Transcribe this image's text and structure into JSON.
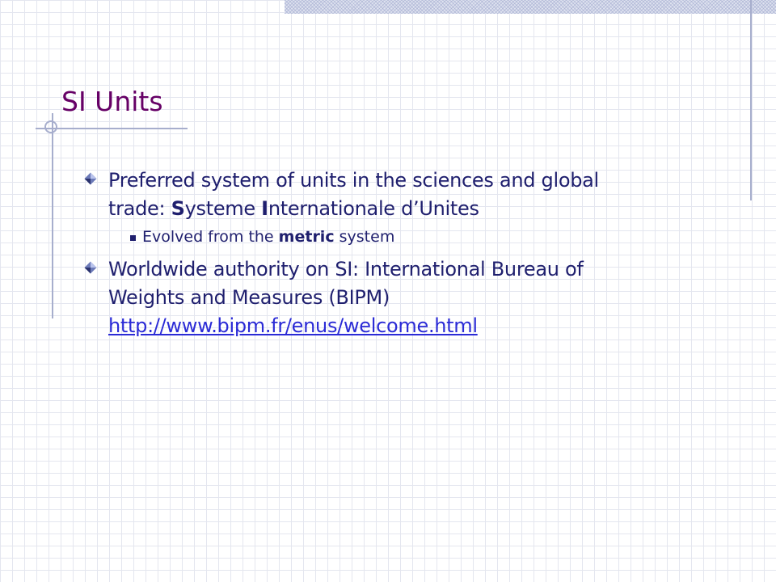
{
  "slide": {
    "title": "SI Units",
    "bullet_1": {
      "line_1": "Preferred system of units in the sciences and global",
      "line_2_prefix": "trade: ",
      "s_initial": "S",
      "s_rest": "ysteme ",
      "i_initial": "I",
      "i_rest": "nternationale d’Unites"
    },
    "sub_bullet": {
      "prefix": "Evolved from the ",
      "emphasis": "metric",
      "suffix": " system"
    },
    "bullet_2": {
      "line_1": "Worldwide authority on SI: International Bureau of",
      "line_2": "Weights and Measures (BIPM)",
      "link": "http://www.bipm.fr/enus/welcome.html"
    }
  },
  "colors": {
    "title": "#660066",
    "body": "#1f1f6e",
    "link": "#2b2bd6",
    "accent_lines": "#a7aecd",
    "grid": "#e4e6ef"
  },
  "icons": {
    "level_1_bullet": "diamond-bullet-icon",
    "level_2_bullet": "square-bullet-icon"
  }
}
